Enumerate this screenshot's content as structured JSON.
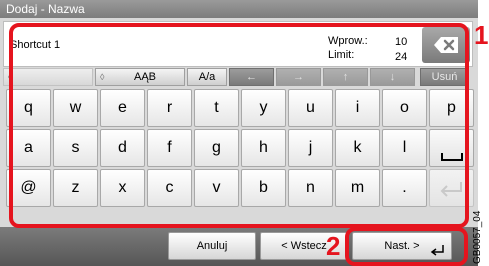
{
  "window": {
    "title": "Dodaj - Nazwa"
  },
  "input": {
    "value": "Shortcut 1"
  },
  "counter": {
    "entered_label": "Wprow.:",
    "entered_value": "10",
    "limit_label": "Limit:",
    "limit_value": "24"
  },
  "toolbar": {
    "mode_button_label": "AĄB",
    "case_button_label": "A/a",
    "delete_label": "Usuń"
  },
  "keyboard": {
    "row1": [
      "q",
      "w",
      "e",
      "r",
      "t",
      "y",
      "u",
      "i",
      "o",
      "p"
    ],
    "row2": [
      "a",
      "s",
      "d",
      "f",
      "g",
      "h",
      "j",
      "k",
      "l"
    ],
    "row3": [
      "@",
      "z",
      "x",
      "c",
      "v",
      "b",
      "n",
      "m",
      "."
    ]
  },
  "bottom": {
    "cancel_label": "Anuluj",
    "back_label": "< Wstecz",
    "next_label": "Nast. >"
  },
  "callouts": {
    "badge1": "1",
    "badge2": "2"
  },
  "figure_code": "GB0057_04",
  "colors": {
    "callout_red": "#e5141e",
    "title_bar": "#8c8c8c",
    "bottom_bar": "#666666"
  }
}
